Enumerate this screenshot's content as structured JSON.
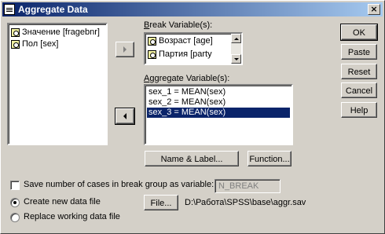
{
  "window": {
    "title": "Aggregate Data",
    "close_glyph": "×"
  },
  "source_variables": [
    {
      "label": "Значение [fragebnr]",
      "icon": "scale-variable-icon"
    },
    {
      "label": "Пол [sex]",
      "icon": "scale-variable-icon"
    }
  ],
  "break": {
    "label_pre": "",
    "label_u": "B",
    "label_post": "reak Variable(s):",
    "items": [
      {
        "label": "Возраст [age]",
        "icon": "scale-variable-icon"
      },
      {
        "label": "Партия [party",
        "icon": "scale-variable-icon"
      }
    ]
  },
  "aggregate": {
    "label_pre": "",
    "label_u": "A",
    "label_post": "ggregate Variable(s):",
    "items": [
      {
        "label": "sex_1 = MEAN(sex)",
        "selected": false
      },
      {
        "label": "sex_2 = MEAN(sex)",
        "selected": false
      },
      {
        "label": "sex_3 = MEAN(sex)",
        "selected": true
      }
    ],
    "name_label_button": "Name & Label...",
    "function_button": "Function..."
  },
  "actions": {
    "ok": "OK",
    "paste": "Paste",
    "reset": "Reset",
    "cancel": "Cancel",
    "help": "Help"
  },
  "options": {
    "save_cases_label": "Save number of cases in break group as variable:",
    "save_cases_checked": false,
    "save_cases_value": "N_BREAK",
    "create_new_label": "Create new data file",
    "create_new_selected": true,
    "file_button": "File...",
    "file_path": "D:\\Работа\\SPSS\\base\\aggr.sav",
    "replace_label": "Replace working data file",
    "replace_selected": false
  }
}
